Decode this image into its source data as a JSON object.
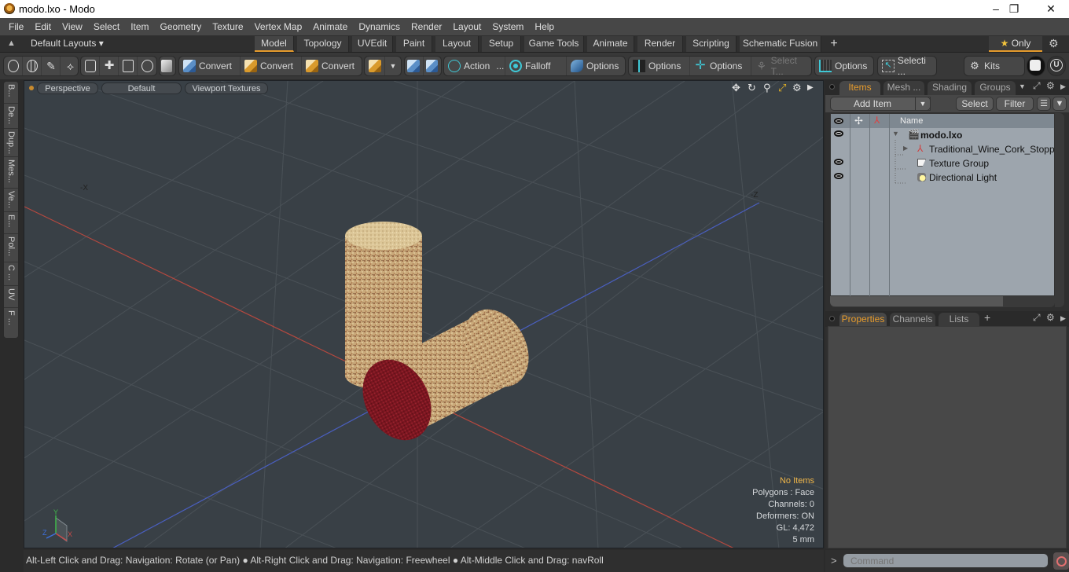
{
  "window": {
    "title": "modo.lxo - Modo",
    "controls": {
      "minimize": "–",
      "maximize": "❐",
      "close": "✕"
    }
  },
  "menu": [
    "File",
    "Edit",
    "View",
    "Select",
    "Item",
    "Geometry",
    "Texture",
    "Vertex Map",
    "Animate",
    "Dynamics",
    "Render",
    "Layout",
    "System",
    "Help"
  ],
  "layoutbar": {
    "layouts_label": "Default Layouts ▾",
    "tabs": [
      "Model",
      "Topology",
      "UVEdit",
      "Paint",
      "Layout",
      "Setup",
      "Game Tools",
      "Animate",
      "Render",
      "Scripting",
      "Schematic Fusion"
    ],
    "active_tab": "Model",
    "add_tab": "+",
    "only_label": "Only",
    "star": "★"
  },
  "toolbar": {
    "convert1": "Convert",
    "convert2": "Convert",
    "convert3": "Convert",
    "action": "Action",
    "action_more": "...",
    "falloff": "Falloff",
    "options1": "Options",
    "options2": "Options",
    "options3": "Options",
    "select_t": "Select T...",
    "options4": "Options",
    "selecti": "Selecti ...",
    "kits": "Kits"
  },
  "left_tool_tabs": [
    "B...",
    "De...",
    "Dup...",
    "Mes...",
    "Ve...",
    "E...",
    "Pol...",
    "C ...",
    "UV",
    "F ..."
  ],
  "viewport": {
    "view_mode": "Perspective",
    "shading": "Default",
    "textures": "Viewport Textures",
    "axis_labels": {
      "neg_x": "-X",
      "neg_z": "-Z"
    },
    "gizmo_labels": {
      "x": "X",
      "y": "Y",
      "z": "Z"
    },
    "stats": {
      "selection": "No Items",
      "polygons": "Polygons : Face",
      "channels": "Channels: 0",
      "deformers": "Deformers: ON",
      "gl": "GL: 4,472",
      "unit": "5 mm"
    },
    "colors": {
      "x_axis": "#b5483f",
      "z_axis": "#4a5fc0",
      "grid": "#4a5157",
      "background": "#394046"
    }
  },
  "items_panel": {
    "tabs": [
      "Items",
      "Mesh ...",
      "Shading",
      "Groups"
    ],
    "active_tab": "Items",
    "add_item": "Add Item",
    "select": "Select",
    "filter": "Filter",
    "column_name": "Name",
    "tree": [
      {
        "name": "modo.lxo",
        "level": 0,
        "visible": true,
        "expanded": true,
        "bold": true,
        "icon": "scene-clapper-icon"
      },
      {
        "name": "Traditional_Wine_Cork_Stopper",
        "level": 1,
        "visible": false,
        "expanded": false,
        "bold": false,
        "icon": "mesh-locator-icon"
      },
      {
        "name": "Texture Group",
        "level": 1,
        "visible": true,
        "bold": false,
        "icon": "texture-group-icon"
      },
      {
        "name": "Directional Light",
        "level": 1,
        "visible": true,
        "bold": false,
        "icon": "directional-light-icon"
      }
    ]
  },
  "properties_panel": {
    "tabs": [
      "Properties",
      "Channels",
      "Lists"
    ],
    "active_tab": "Properties",
    "add_tab": "+"
  },
  "statusbar": {
    "hint": "Alt-Left Click and Drag: Navigation: Rotate (or Pan) ● Alt-Right Click and Drag: Navigation: Freewheel ● Alt-Middle Click and Drag: navRoll"
  },
  "command": {
    "prompt": ">",
    "placeholder": "Command"
  },
  "accent_color": "#e89c2c"
}
